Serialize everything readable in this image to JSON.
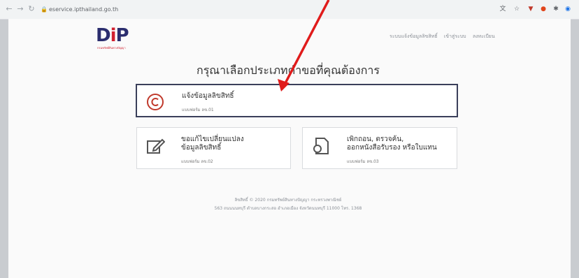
{
  "browser": {
    "url": "eservice.ipthailand.go.th",
    "back_icon": "arrow-left-icon",
    "forward_icon": "arrow-right-icon",
    "reload_icon": "reload-icon"
  },
  "header": {
    "logo_main_1": "D",
    "logo_main_2": "i",
    "logo_main_3": "P",
    "logo_sub": "กรมทรัพย์สินทางปัญญา",
    "nav_items": [
      "ระบบแจ้งข้อมูลลิขสิทธิ์",
      "เข้าสู่ระบบ",
      "ลงทะเบียน"
    ]
  },
  "main": {
    "heading": "กรุณาเลือกประเภทคำขอที่คุณต้องการ",
    "cards": [
      {
        "title": "แจ้งข้อมูลลิขสิทธิ์",
        "subtitle": "แบบฟอร์ม ลข.01",
        "icon": "copyright-icon"
      },
      {
        "title": "ขอแก้ไขเปลี่ยนแปลง\nข้อมูลลิขสิทธิ์",
        "subtitle": "แบบฟอร์ม ลข.02",
        "icon": "edit-icon"
      },
      {
        "title": "เพิกถอน, ตรวจค้น,\nออกหนังสือรับรอง หรือใบแทน",
        "subtitle": "แบบฟอร์ม ลข.03",
        "icon": "certificate-icon"
      }
    ]
  },
  "footer": {
    "line1": "ลิขสิทธิ์ © 2020 กรมทรัพย์สินทางปัญญา กระทรวงพาณิชย์",
    "line2": "563 ถนนนนทบุรี ตำบลบางกระสอ อำเภอเมือง จังหวัดนนทบุรี 11000 โทร. 1368"
  },
  "colors": {
    "brand_blue": "#2b2d6e",
    "brand_red": "#d1202f",
    "annotation_arrow": "#e01b1b"
  }
}
